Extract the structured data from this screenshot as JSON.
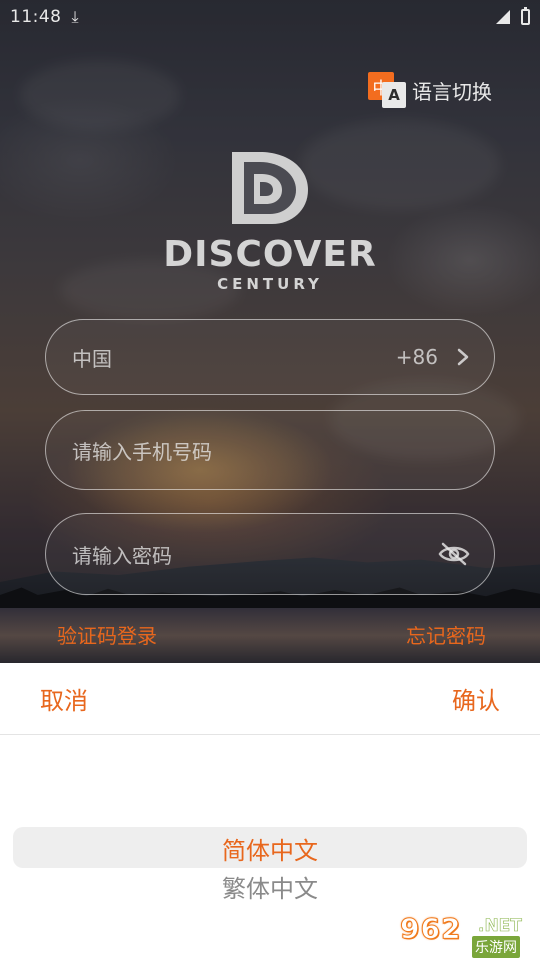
{
  "status_bar": {
    "time": "11:48",
    "download_icon": "download-arrow-icon",
    "signal_icon": "signal-icon",
    "battery_icon": "battery-icon"
  },
  "language_switch": {
    "icon": "translate-icon",
    "icon_glyph_zh": "中",
    "icon_glyph_a": "A",
    "label": "语言切换"
  },
  "logo": {
    "name": "DISCOVER",
    "subtitle": "CENTURY"
  },
  "form": {
    "country": {
      "label": "中国",
      "code": "+86",
      "chevron_icon": "chevron-right-icon"
    },
    "phone": {
      "placeholder": "请输入手机号码"
    },
    "password": {
      "placeholder": "请输入密码",
      "visibility_icon": "eye-off-icon"
    },
    "sms_login_link": "验证码登录",
    "forgot_password_link": "忘记密码"
  },
  "picker_sheet": {
    "cancel_label": "取消",
    "confirm_label": "确认",
    "options": [
      "简体中文",
      "繁体中文"
    ],
    "selected_index": 0
  },
  "watermark": {
    "number": "962",
    "domain": ".NET",
    "cn_text": "乐游网"
  },
  "colors": {
    "accent": "#e8671d",
    "sheet_bg": "#ffffff",
    "picker_highlight": "#eeeeee",
    "unselected_text": "#8a8a8a"
  }
}
